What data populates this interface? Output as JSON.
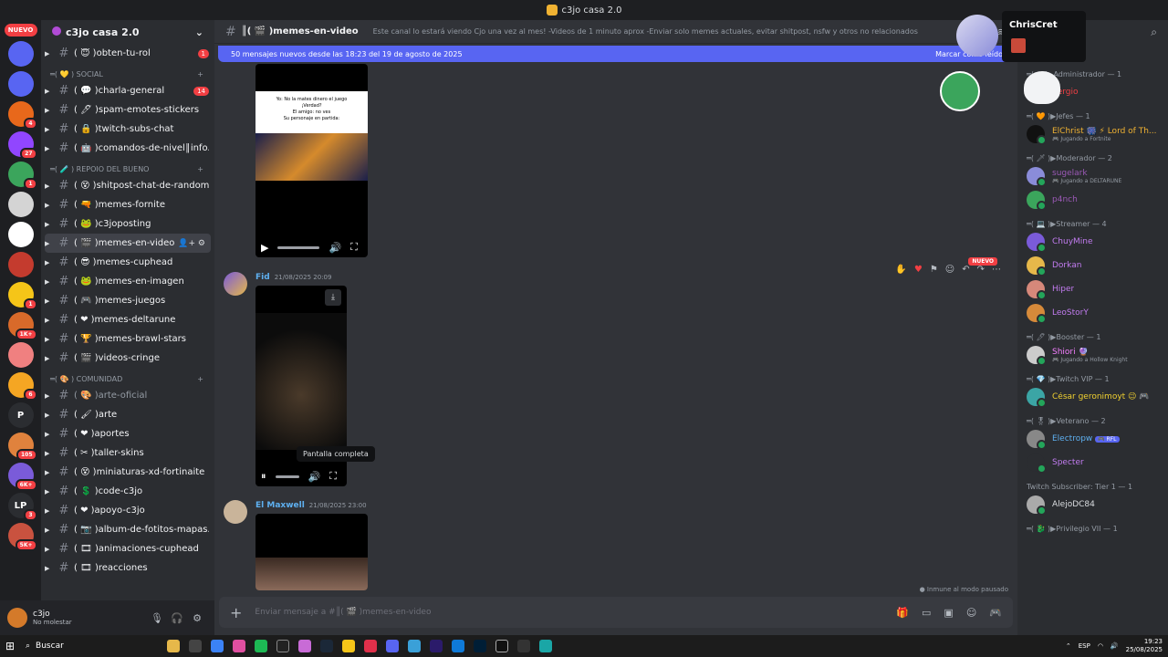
{
  "window": {
    "title": "c3jo casa 2.0"
  },
  "servers": {
    "new_label": "NUEVO",
    "items": [
      {
        "color": "#5865f2",
        "label": "",
        "badge": ""
      },
      {
        "color": "#5865f2",
        "label": "",
        "badge": ""
      },
      {
        "color": "#e8681b",
        "label": "",
        "badge": "4"
      },
      {
        "color": "#9146ff",
        "label": "",
        "badge": "27"
      },
      {
        "color": "#3ba55c",
        "label": "",
        "badge": "1"
      },
      {
        "color": "#d4d4d4",
        "label": "",
        "badge": ""
      },
      {
        "color": "#ffffff",
        "label": "",
        "badge": ""
      },
      {
        "color": "#c43b2e",
        "label": "",
        "badge": ""
      },
      {
        "color": "#f5c518",
        "label": "",
        "badge": "1"
      },
      {
        "color": "#d86a2a",
        "label": "",
        "badge": "1K+"
      },
      {
        "color": "#f08080",
        "label": "",
        "badge": ""
      },
      {
        "color": "#f5a623",
        "label": "",
        "badge": "6"
      },
      {
        "color": "#2b2d31",
        "label": "P",
        "badge": ""
      },
      {
        "color": "#e0823d",
        "label": "",
        "badge": "105"
      },
      {
        "color": "#7a5bd9",
        "label": "",
        "badge": "6K+"
      },
      {
        "color": "#2b2d31",
        "label": "LP",
        "badge": "3"
      },
      {
        "color": "#c9523f",
        "label": "",
        "badge": "5K+"
      }
    ]
  },
  "guild": {
    "name": "c3jo casa 2.0",
    "channels_top": [
      {
        "name": "( 😇 )obten-tu-rol",
        "badge": "1",
        "muted": false
      }
    ],
    "categories": [
      {
        "label": "═( 💛 ) SOCIAL",
        "channels": [
          {
            "name": "( 💬 )charla-general",
            "badge": "14",
            "muted": false
          },
          {
            "name": "( 🖊 )spam-emotes-stickers",
            "badge": "",
            "muted": false
          },
          {
            "name": "( 🔒 )twitch-subs-chat",
            "badge": "",
            "muted": false
          },
          {
            "name": "( 🤖 )comandos-de-nivel║info...",
            "badge": "",
            "muted": false
          }
        ]
      },
      {
        "label": "═( 🧪 ) REPOIO DEL BUENO",
        "channels": [
          {
            "name": "( 😵 )shitpost-chat-de-randoms",
            "badge": "",
            "muted": false
          },
          {
            "name": "( 🔫 )memes-fornite",
            "badge": "",
            "muted": false
          },
          {
            "name": "( 🐸 )c3joposting",
            "badge": "",
            "muted": false
          },
          {
            "name": "( 🎬 )memes-en-video",
            "badge": "",
            "muted": false,
            "active": true
          },
          {
            "name": "( 😎 )memes-cuphead",
            "badge": "",
            "muted": false
          },
          {
            "name": "( 🐸 )memes-en-imagen",
            "badge": "",
            "muted": false
          },
          {
            "name": "( 🎮 )memes-juegos",
            "badge": "",
            "muted": false
          },
          {
            "name": "( ❤ )memes-deltarune",
            "badge": "",
            "muted": false
          },
          {
            "name": "( 🏆 )memes-brawl-stars",
            "badge": "",
            "muted": false
          },
          {
            "name": "( 🎬 )videos-cringe",
            "badge": "",
            "muted": false
          }
        ]
      },
      {
        "label": "═( 🎨 ) COMUNIDAD",
        "channels": [
          {
            "name": "( 🎨 )arte-oficial",
            "badge": "",
            "muted": true
          },
          {
            "name": "( 🖌 )arte",
            "badge": "",
            "muted": false
          },
          {
            "name": "( ❤ )aportes",
            "badge": "",
            "muted": false
          },
          {
            "name": "( ✂ )taller-skins",
            "badge": "",
            "muted": false
          },
          {
            "name": "( 😵 )miniaturas-xd-fortinaite",
            "badge": "",
            "muted": false
          },
          {
            "name": "( 💲 )code-c3jo",
            "badge": "",
            "muted": false
          },
          {
            "name": "( ❤ )apoyo-c3jo",
            "badge": "",
            "muted": false
          },
          {
            "name": "( 📷 )album-de-fotitos-mapas...",
            "badge": "",
            "muted": false
          },
          {
            "name": "( 🎞 )animaciones-cuphead",
            "badge": "",
            "muted": false
          },
          {
            "name": "( 🎞 )reacciones",
            "badge": "",
            "muted": false
          }
        ]
      }
    ]
  },
  "user": {
    "name": "c3jo",
    "status": "No molestar"
  },
  "channel": {
    "name": "║( 🎬 )memes-en-video",
    "topic": "Este canal lo estará viendo Cjo una vez al mes! -Videos de 1 minuto aprox -Enviar solo memes actuales, evitar shitpost, nsfw y otros no relacionados"
  },
  "new_messages_bar": {
    "text": "50 mensajes nuevos desde las 18:23 del 19 de agosto de 2025",
    "action": "Marcar como leído"
  },
  "video1": {
    "caption_lines": [
      "Yo: No la mates dinero el juego",
      "¡Verdad?",
      "El amigo: no ves",
      "Su personaje en partida:"
    ]
  },
  "message2": {
    "author": "Fid",
    "time": "21/08/2025 20:09",
    "new_badge": "NUEVO",
    "tooltip": "Pantalla completa"
  },
  "message3": {
    "author": "El Maxwell",
    "time": "21/08/2025 23:00"
  },
  "immune_note": "Inmune al modo pausado",
  "composer": {
    "placeholder": "Enviar mensaje a #║( 🎬 )memes-en-video"
  },
  "overlay": {
    "name": "ChrisCret"
  },
  "members": {
    "groups": [
      {
        "label": "C3jo — 1",
        "members": []
      },
      {
        "label": "═( ⚙ )▶Administrador — 1",
        "members": [
          {
            "name": "Sergio",
            "sub": "",
            "color": "#f23f43",
            "av": "#6d6f78"
          }
        ]
      },
      {
        "label": "═( 🧡 )▶Jefes — 1",
        "members": [
          {
            "name": "ElChrist 🎆 ⚡ Lord of Th...",
            "sub": "🎮 Jugando a Fortnite",
            "color": "#f0b232",
            "av": "#111"
          }
        ]
      },
      {
        "label": "═( 🗡 )▶Moderador — 2",
        "members": [
          {
            "name": "sugelark",
            "sub": "🎮 Jugando a DELTARUNE",
            "color": "#9b59b6",
            "av": "#8a8cd9"
          },
          {
            "name": "p4nch",
            "sub": "",
            "color": "#9b59b6",
            "av": "#3ba55c"
          }
        ]
      },
      {
        "label": "═( 💻 )▶Streamer — 4",
        "members": [
          {
            "name": "ChuyMine",
            "sub": "",
            "color": "#c27cf0",
            "av": "#7a5bd9"
          },
          {
            "name": "Dorkan",
            "sub": "",
            "color": "#c27cf0",
            "av": "#e6b84a"
          },
          {
            "name": "Hiper",
            "sub": "",
            "color": "#c27cf0",
            "av": "#d6887a"
          },
          {
            "name": "LeoStorY",
            "sub": "",
            "color": "#c27cf0",
            "av": "#d68a3a"
          }
        ]
      },
      {
        "label": "═( 🖊 )▶Booster — 1",
        "members": [
          {
            "name": "Shiori 🔮",
            "sub": "🎮 Jugando a Hollow Knight",
            "color": "#f47fff",
            "av": "#ccc"
          }
        ]
      },
      {
        "label": "═( 💎 )▶Twitch VIP — 1",
        "members": [
          {
            "name": "César geronimoyt 😉 🎮",
            "sub": "",
            "color": "#f0d030",
            "av": "#3ba5a5"
          }
        ]
      },
      {
        "label": "═( 🎖 )▶Veterano — 2",
        "members": [
          {
            "name": "Electropw",
            "tag": "🎮 RFL",
            "sub": "",
            "color": "#5eb0f0",
            "av": "#888"
          },
          {
            "name": "Specter",
            "sub": "",
            "color": "#c27cf0",
            "av": "#2b2d31"
          }
        ]
      },
      {
        "label": "Twitch Subscriber: Tier 1 — 1",
        "members": [
          {
            "name": "AlejoDC84",
            "sub": "",
            "color": "#dbdee1",
            "av": "#aaa"
          }
        ]
      },
      {
        "label": "═( 🐉 )▶Privilegio VII — 1",
        "members": []
      }
    ]
  },
  "taskbar": {
    "search": "Buscar",
    "lang": "ESP",
    "time": "19:23",
    "date": "25/08/2025"
  }
}
